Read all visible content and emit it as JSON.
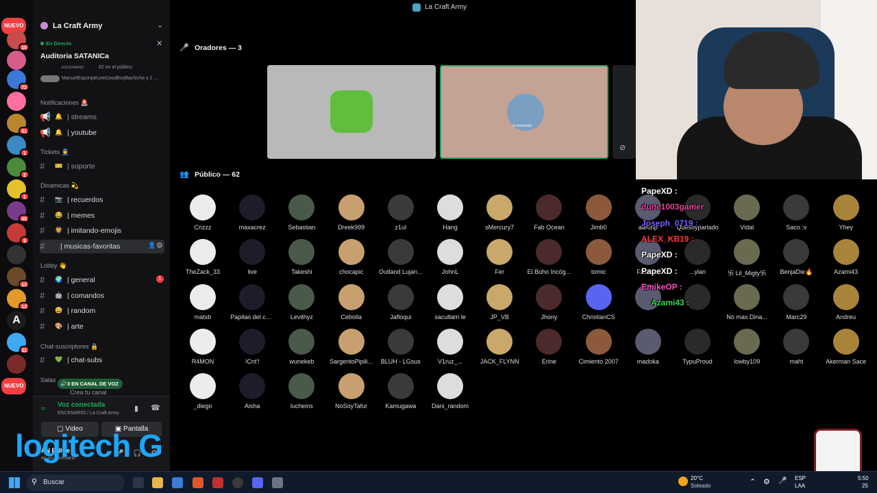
{
  "window": {
    "title": "La Craft Army"
  },
  "servers": {
    "badges": [
      "NUEVO",
      "10",
      "72",
      "31",
      "1",
      "2",
      "1",
      "45",
      "3",
      "13",
      "13",
      "11",
      "NUEVO"
    ]
  },
  "sidebar": {
    "guild": "La Craft Army",
    "live": {
      "tag": "En Directo",
      "title": "Auditoria SATANICa",
      "stage_tag": "ESCENARIO",
      "audience": "62 en el público",
      "speakers": "ManuelEsponjaKureGoodBoyBachicha y 2 ..."
    },
    "categories": [
      "Notificaciones 🚨",
      "Tickets 👮",
      "Dinamicas 💫",
      "Lobby 👋",
      "Chat-suscriptores 🔒",
      "Salas"
    ],
    "channels": [
      {
        "emoji": "🔔",
        "name": "| streams"
      },
      {
        "emoji": "🔔",
        "name": "| youtube"
      },
      {
        "emoji": "🎫",
        "name": "| soporte"
      },
      {
        "emoji": "📷",
        "name": "| recuerdos"
      },
      {
        "emoji": "😂",
        "name": "| memes"
      },
      {
        "emoji": "🦁",
        "name": "| imitando-emojis"
      },
      {
        "emoji": "",
        "name": "| musicas-favoritas"
      },
      {
        "emoji": "🌍",
        "name": "| general"
      },
      {
        "emoji": "🤖",
        "name": "| comandos"
      },
      {
        "emoji": "😄",
        "name": "| random"
      },
      {
        "emoji": "🎨",
        "name": "| arte"
      },
      {
        "emoji": "💚",
        "name": "| chat-subs"
      }
    ],
    "general_badge": "1",
    "voice_pill": "3 EN CANAL DE VOZ",
    "create_channel": "Crea tu canal",
    "voice": {
      "status": "Voz conectada",
      "detail": "ESCENARIO / La Craft Army",
      "video": "Video",
      "screen": "Pantalla"
    },
    "user": {
      "name": "AN ENICe",
      "sub": "en un escenario"
    }
  },
  "stage": {
    "speakers_label": "Oradores — 3",
    "public_label": "Público — 62",
    "tile_label": "el exxxtranio",
    "audience": [
      "Crizzz",
      "maxacrez",
      "Sebastian",
      "Dreek999",
      "z1ul",
      "Hang",
      "sMercury7",
      "Fab Ocean",
      "Jimb0",
      "aaronp",
      "Quesoyparlado",
      "Vidal",
      "Saco :v",
      "Yhey",
      "TheZack_33",
      "live",
      "Takeshi",
      "chocapic",
      "Outland Lujan...",
      "JohnL",
      "Fer",
      "El Búho Incóg...",
      "tomic",
      "Franki...",
      "...ylan",
      "卐 Lil_Migty卐",
      "BenjaDie🔥",
      "Azami43",
      "matxb",
      "Papitas del ca...",
      "Levithyz",
      "Cebolla",
      "Jafloqui",
      "sacultam le",
      "JP_VB",
      "Jhony",
      "ChristianCS",
      "",
      "",
      "No mas Dina...",
      "Marc29",
      "Andreu",
      "R4MON",
      "!Cnt'!",
      "wunekeb",
      "SargentoPipili...",
      "BLUH - LGsus",
      "V1ruz_...",
      "JACK_FLYNN",
      "Erine",
      "Cimiento 2007",
      "madoka",
      "TypuProud",
      "lowby109",
      "maht",
      "Akerman Sace",
      "_diego",
      "Aisha",
      "lucheins",
      "NoSoyTafur",
      "Kamugawa",
      "Dani_random"
    ]
  },
  "overlay_chat": [
    {
      "user": "PapeXD :",
      "color": "#ffffff"
    },
    {
      "user": "dune1003gamer",
      "color": "#e8439a"
    },
    {
      "user": "Joseph_0719 :",
      "color": "#7b5cff"
    },
    {
      "user": "ALEX_KB19 :",
      "color": "#ff3b3b"
    },
    {
      "user": "PapeXD :",
      "color": "#ffffff"
    },
    {
      "user": "PapeXD :",
      "color": "#ffffff"
    },
    {
      "user": "EmikeOP :",
      "color": "#ff4fc3"
    },
    {
      "user": "Azami43 :",
      "color": "#39d353"
    }
  ],
  "logo": "logitech G",
  "taskbar": {
    "search": "Buscar",
    "temp": "20°C",
    "weather": "Soleado",
    "lang1": "ESP",
    "lang2": "LAA",
    "time": "5:50",
    "date": "25"
  }
}
